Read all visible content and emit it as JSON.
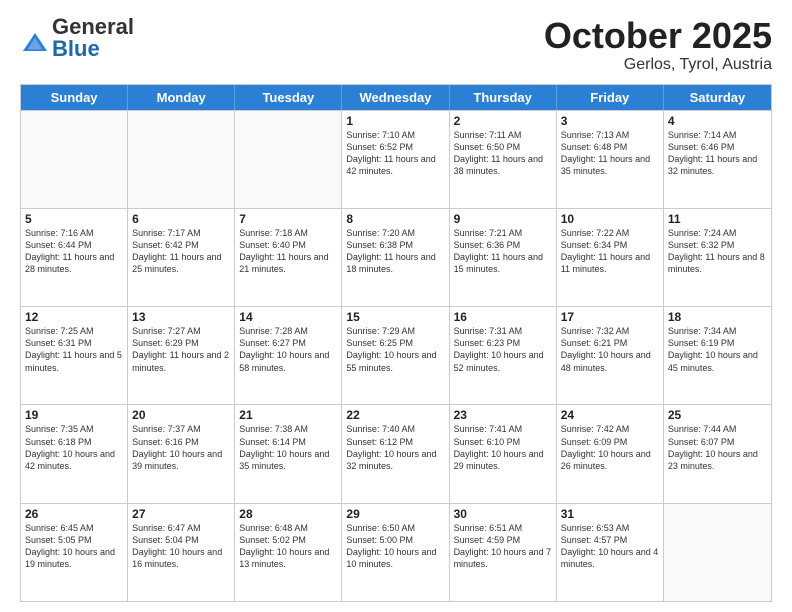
{
  "header": {
    "logo_general": "General",
    "logo_blue": "Blue",
    "title": "October 2025",
    "subtitle": "Gerlos, Tyrol, Austria"
  },
  "days_of_week": [
    "Sunday",
    "Monday",
    "Tuesday",
    "Wednesday",
    "Thursday",
    "Friday",
    "Saturday"
  ],
  "weeks": [
    [
      {
        "day": "",
        "info": "",
        "empty": true
      },
      {
        "day": "",
        "info": "",
        "empty": true
      },
      {
        "day": "",
        "info": "",
        "empty": true
      },
      {
        "day": "1",
        "info": "Sunrise: 7:10 AM\nSunset: 6:52 PM\nDaylight: 11 hours and 42 minutes.",
        "empty": false
      },
      {
        "day": "2",
        "info": "Sunrise: 7:11 AM\nSunset: 6:50 PM\nDaylight: 11 hours and 38 minutes.",
        "empty": false
      },
      {
        "day": "3",
        "info": "Sunrise: 7:13 AM\nSunset: 6:48 PM\nDaylight: 11 hours and 35 minutes.",
        "empty": false
      },
      {
        "day": "4",
        "info": "Sunrise: 7:14 AM\nSunset: 6:46 PM\nDaylight: 11 hours and 32 minutes.",
        "empty": false
      }
    ],
    [
      {
        "day": "5",
        "info": "Sunrise: 7:16 AM\nSunset: 6:44 PM\nDaylight: 11 hours and 28 minutes.",
        "empty": false
      },
      {
        "day": "6",
        "info": "Sunrise: 7:17 AM\nSunset: 6:42 PM\nDaylight: 11 hours and 25 minutes.",
        "empty": false
      },
      {
        "day": "7",
        "info": "Sunrise: 7:18 AM\nSunset: 6:40 PM\nDaylight: 11 hours and 21 minutes.",
        "empty": false
      },
      {
        "day": "8",
        "info": "Sunrise: 7:20 AM\nSunset: 6:38 PM\nDaylight: 11 hours and 18 minutes.",
        "empty": false
      },
      {
        "day": "9",
        "info": "Sunrise: 7:21 AM\nSunset: 6:36 PM\nDaylight: 11 hours and 15 minutes.",
        "empty": false
      },
      {
        "day": "10",
        "info": "Sunrise: 7:22 AM\nSunset: 6:34 PM\nDaylight: 11 hours and 11 minutes.",
        "empty": false
      },
      {
        "day": "11",
        "info": "Sunrise: 7:24 AM\nSunset: 6:32 PM\nDaylight: 11 hours and 8 minutes.",
        "empty": false
      }
    ],
    [
      {
        "day": "12",
        "info": "Sunrise: 7:25 AM\nSunset: 6:31 PM\nDaylight: 11 hours and 5 minutes.",
        "empty": false
      },
      {
        "day": "13",
        "info": "Sunrise: 7:27 AM\nSunset: 6:29 PM\nDaylight: 11 hours and 2 minutes.",
        "empty": false
      },
      {
        "day": "14",
        "info": "Sunrise: 7:28 AM\nSunset: 6:27 PM\nDaylight: 10 hours and 58 minutes.",
        "empty": false
      },
      {
        "day": "15",
        "info": "Sunrise: 7:29 AM\nSunset: 6:25 PM\nDaylight: 10 hours and 55 minutes.",
        "empty": false
      },
      {
        "day": "16",
        "info": "Sunrise: 7:31 AM\nSunset: 6:23 PM\nDaylight: 10 hours and 52 minutes.",
        "empty": false
      },
      {
        "day": "17",
        "info": "Sunrise: 7:32 AM\nSunset: 6:21 PM\nDaylight: 10 hours and 48 minutes.",
        "empty": false
      },
      {
        "day": "18",
        "info": "Sunrise: 7:34 AM\nSunset: 6:19 PM\nDaylight: 10 hours and 45 minutes.",
        "empty": false
      }
    ],
    [
      {
        "day": "19",
        "info": "Sunrise: 7:35 AM\nSunset: 6:18 PM\nDaylight: 10 hours and 42 minutes.",
        "empty": false
      },
      {
        "day": "20",
        "info": "Sunrise: 7:37 AM\nSunset: 6:16 PM\nDaylight: 10 hours and 39 minutes.",
        "empty": false
      },
      {
        "day": "21",
        "info": "Sunrise: 7:38 AM\nSunset: 6:14 PM\nDaylight: 10 hours and 35 minutes.",
        "empty": false
      },
      {
        "day": "22",
        "info": "Sunrise: 7:40 AM\nSunset: 6:12 PM\nDaylight: 10 hours and 32 minutes.",
        "empty": false
      },
      {
        "day": "23",
        "info": "Sunrise: 7:41 AM\nSunset: 6:10 PM\nDaylight: 10 hours and 29 minutes.",
        "empty": false
      },
      {
        "day": "24",
        "info": "Sunrise: 7:42 AM\nSunset: 6:09 PM\nDaylight: 10 hours and 26 minutes.",
        "empty": false
      },
      {
        "day": "25",
        "info": "Sunrise: 7:44 AM\nSunset: 6:07 PM\nDaylight: 10 hours and 23 minutes.",
        "empty": false
      }
    ],
    [
      {
        "day": "26",
        "info": "Sunrise: 6:45 AM\nSunset: 5:05 PM\nDaylight: 10 hours and 19 minutes.",
        "empty": false
      },
      {
        "day": "27",
        "info": "Sunrise: 6:47 AM\nSunset: 5:04 PM\nDaylight: 10 hours and 16 minutes.",
        "empty": false
      },
      {
        "day": "28",
        "info": "Sunrise: 6:48 AM\nSunset: 5:02 PM\nDaylight: 10 hours and 13 minutes.",
        "empty": false
      },
      {
        "day": "29",
        "info": "Sunrise: 6:50 AM\nSunset: 5:00 PM\nDaylight: 10 hours and 10 minutes.",
        "empty": false
      },
      {
        "day": "30",
        "info": "Sunrise: 6:51 AM\nSunset: 4:59 PM\nDaylight: 10 hours and 7 minutes.",
        "empty": false
      },
      {
        "day": "31",
        "info": "Sunrise: 6:53 AM\nSunset: 4:57 PM\nDaylight: 10 hours and 4 minutes.",
        "empty": false
      },
      {
        "day": "",
        "info": "",
        "empty": true
      }
    ]
  ]
}
